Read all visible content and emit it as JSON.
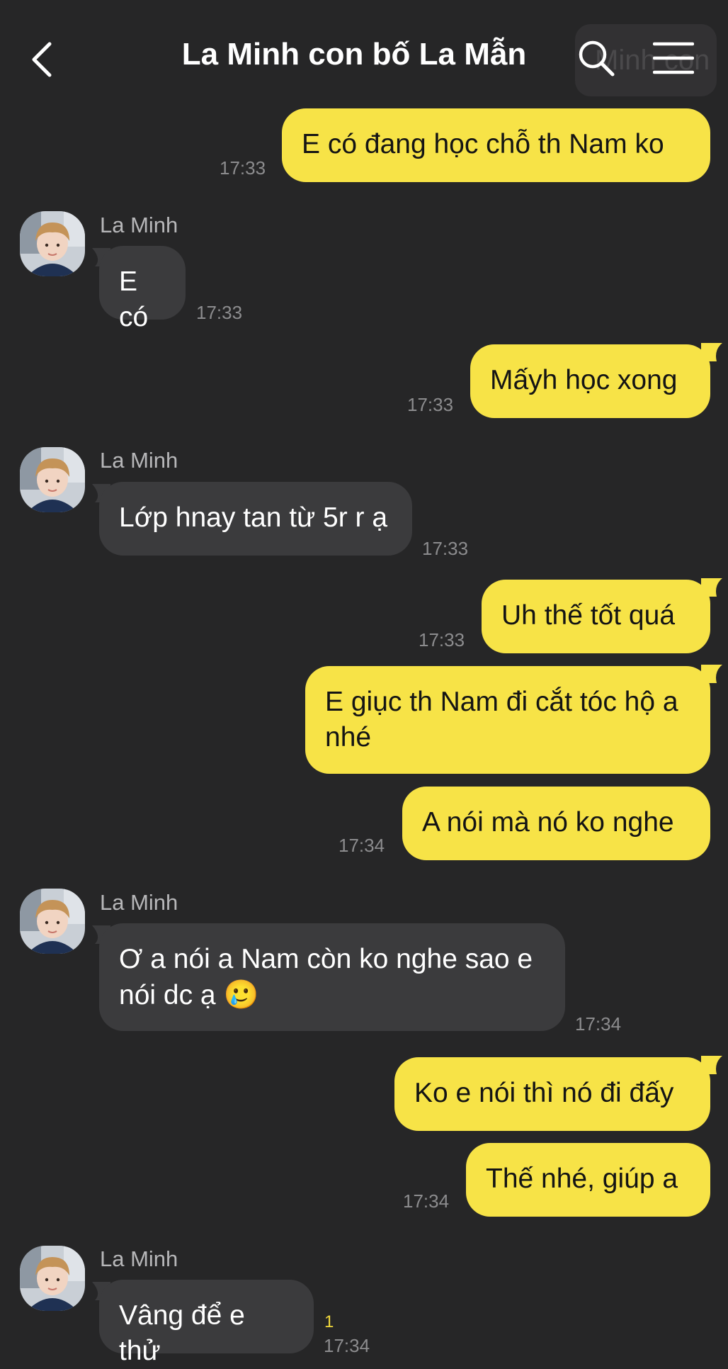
{
  "header": {
    "title": "La Minh con bố La Mẫn",
    "ghost_chip_text": "Minh con"
  },
  "messages": [
    {
      "side": "out",
      "text": "E có đang học chỗ th Nam ko",
      "time": "17:33"
    },
    {
      "side": "in",
      "sender": "La Minh",
      "text": "E có",
      "time": "17:33"
    },
    {
      "side": "out",
      "text": "Mấyh học xong",
      "time": "17:33"
    },
    {
      "side": "in",
      "sender": "La Minh",
      "text": "Lớp hnay tan từ 5r r ạ",
      "time": "17:33"
    },
    {
      "side": "out",
      "text": "Uh thế tốt quá",
      "time": "17:33"
    },
    {
      "side": "out",
      "text": "E giục th Nam đi cắt tóc hộ a nhé"
    },
    {
      "side": "out",
      "text": "A nói mà nó ko nghe",
      "time": "17:34"
    },
    {
      "side": "in",
      "sender": "La Minh",
      "text": "Ơ a nói a Nam còn ko nghe sao e nói dc ạ",
      "emoji": "🥲",
      "time": "17:34"
    },
    {
      "side": "out",
      "text": "Ko e nói thì nó đi đấy"
    },
    {
      "side": "out",
      "text": "Thế nhé, giúp a",
      "time": "17:34"
    },
    {
      "side": "in",
      "sender": "La Minh",
      "text": "Vâng để e thử",
      "time": "17:34",
      "unread": "1"
    }
  ],
  "colors": {
    "background": "#262627",
    "outgoing_bubble": "#f7e347",
    "incoming_bubble": "#3b3b3d",
    "timestamp": "#8c8c8e",
    "unread_count": "#f2d93c"
  },
  "icons": [
    "back-chevron-icon",
    "search-icon",
    "hamburger-menu-icon"
  ]
}
